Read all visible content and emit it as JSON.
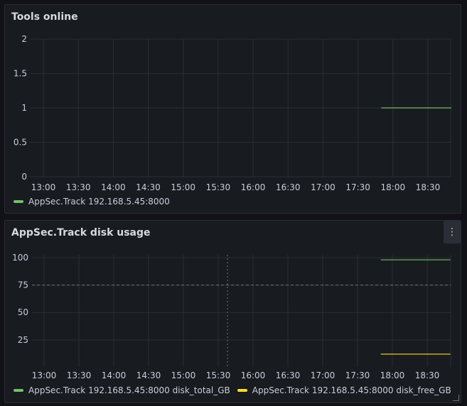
{
  "colors": {
    "green": "#73bf69",
    "yellow": "#fade2a",
    "grid": "#2b2e34",
    "text": "#ccccdc"
  },
  "panels": [
    {
      "title": "Tools online",
      "legend": [
        {
          "label": "AppSec.Track 192.168.5.45:8000",
          "color": "#73bf69"
        }
      ]
    },
    {
      "title": "AppSec.Track disk usage",
      "menu_icon": "kebab-menu-icon",
      "legend": [
        {
          "label": "AppSec.Track 192.168.5.45:8000 disk_total_GB",
          "color": "#73bf69"
        },
        {
          "label": "AppSec.Track 192.168.5.45:8000 disk_free_GB",
          "color": "#fade2a"
        }
      ]
    }
  ],
  "chart_data": [
    {
      "type": "line",
      "title": "Tools online",
      "x_ticks": [
        "13:00",
        "13:30",
        "14:00",
        "14:30",
        "15:00",
        "15:30",
        "16:00",
        "16:30",
        "17:00",
        "17:30",
        "18:00",
        "18:30"
      ],
      "y_ticks": [
        "2",
        "1.5",
        "1",
        "0.5",
        "0"
      ],
      "ylim": [
        0,
        2
      ],
      "grid": true,
      "legend_placement": "bottom-left",
      "series": [
        {
          "name": "AppSec.Track 192.168.5.45:8000",
          "color": "#73bf69",
          "segments": [
            {
              "x": [
                "17:50",
                "18:05"
              ],
              "y": [
                1,
                1
              ]
            },
            {
              "x": [
                "18:05",
                "18:50"
              ],
              "y": [
                1,
                1
              ]
            }
          ]
        }
      ]
    },
    {
      "type": "line",
      "title": "AppSec.Track disk usage",
      "x_ticks": [
        "13:00",
        "13:30",
        "14:00",
        "14:30",
        "15:00",
        "15:30",
        "16:00",
        "16:30",
        "17:00",
        "17:30",
        "18:00",
        "18:30"
      ],
      "y_ticks": [
        "100",
        "75",
        "50",
        "25"
      ],
      "ylim": [
        0,
        110
      ],
      "grid": true,
      "legend_placement": "bottom-left",
      "crosshair_x": "15:38",
      "crosshair_y": 75,
      "series": [
        {
          "name": "AppSec.Track 192.168.5.45:8000 disk_total_GB",
          "color": "#73bf69",
          "segments": [
            {
              "x": [
                "17:50",
                "18:05"
              ],
              "y": [
                98,
                98
              ]
            },
            {
              "x": [
                "18:05",
                "18:50"
              ],
              "y": [
                98,
                98
              ]
            }
          ]
        },
        {
          "name": "AppSec.Track 192.168.5.45:8000 disk_free_GB",
          "color": "#fade2a",
          "segments": [
            {
              "x": [
                "17:50",
                "18:05"
              ],
              "y": [
                12,
                12
              ]
            },
            {
              "x": [
                "18:05",
                "18:50"
              ],
              "y": [
                12,
                12
              ]
            }
          ]
        }
      ]
    }
  ]
}
